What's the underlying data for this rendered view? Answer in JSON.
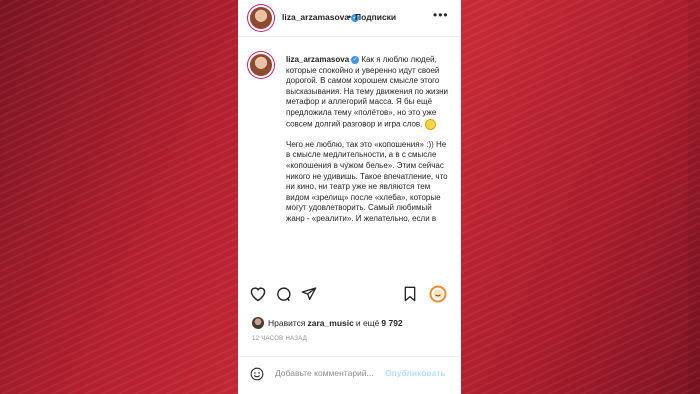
{
  "post": {
    "username": "liza_arzamasova",
    "dot": "•",
    "follow_label": "Подписки",
    "caption_p1": "Как я люблю людей, которые спокойно и уверенно идут своей дорогой. В самом хорошем смысле этого высказывания. На тему движения по жизни метафор и аллегорий масса. Я бы ещё предложила тему «полётов», но это уже совсем долгий разговор и игра слов.",
    "caption_p2": "Чего не люблю, так это «копошения» :)) Не в смысле медлительности, а в с смысле «копошения в чужом белье». Этим сейчас никого не удивишь. Такое впечатление, что ни кино, ни театр уже не являются тем видом «зрелищ» после «хлеба», которые могут удовлетворить. Самый любимый жанр - «реалити». И желательно, если в",
    "likes_prefix": "Нравится",
    "likes_user": "zara_music",
    "likes_middle": "и ещё",
    "likes_count": "9 792",
    "time": "12 ЧАСОВ НАЗАД",
    "comment_placeholder": "Добавьте комментарий...",
    "publish_label": "Опубликовать"
  },
  "icons": [
    "more-icon",
    "verified-icon",
    "heart-icon",
    "comment-icon",
    "share-icon",
    "bookmark-icon",
    "emoji-icon"
  ],
  "colors": {
    "accent": "#3897f0",
    "background_red": "#c72a36"
  }
}
